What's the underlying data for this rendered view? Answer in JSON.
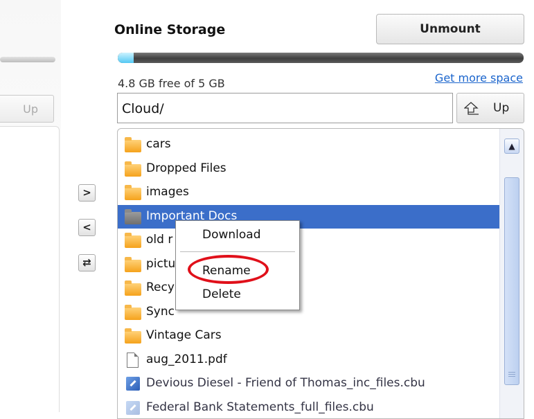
{
  "left_pane": {
    "up_label": "Up"
  },
  "transfer": {
    "copy_right": ">",
    "copy_left": "<",
    "sync": "⇄"
  },
  "storage": {
    "title": "Online Storage",
    "unmount_label": "Unmount",
    "usage_fraction": 0.04,
    "free_text": "4.8 GB free of 5 GB",
    "more_space_link": "Get more space",
    "path_value": "Cloud/",
    "up_label": "Up"
  },
  "files": [
    {
      "name": "cars",
      "type": "folder"
    },
    {
      "name": "Dropped Files",
      "type": "folder"
    },
    {
      "name": "images",
      "type": "folder"
    },
    {
      "name": "Important Docs",
      "type": "folder-grey",
      "selected": true
    },
    {
      "name": "old r",
      "type": "folder"
    },
    {
      "name": "pictu",
      "type": "folder"
    },
    {
      "name": "Recy",
      "type": "folder"
    },
    {
      "name": "Sync",
      "type": "folder"
    },
    {
      "name": "Vintage Cars",
      "type": "folder"
    },
    {
      "name": "aug_2011.pdf",
      "type": "document"
    },
    {
      "name": "Devious Diesel - Friend of Thomas_inc_files.cbu",
      "type": "cbu"
    },
    {
      "name": "Federal Bank Statements_full_files.cbu",
      "type": "cbu",
      "faded": true
    }
  ],
  "context_menu": {
    "download": "Download",
    "rename": "Rename",
    "delete": "Delete"
  },
  "colors": {
    "selection": "#3b6ec9",
    "link": "#1a64cc",
    "highlight_ring": "#e0101a",
    "progress_fill": "#54c8f3"
  },
  "icons": {
    "up": "up-arrow-icon",
    "folder": "folder-icon",
    "document": "document-icon",
    "cbu": "backup-file-icon",
    "scroll_up": "chevron-up-icon"
  }
}
